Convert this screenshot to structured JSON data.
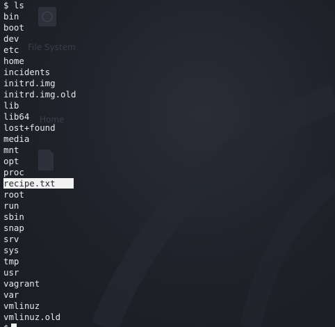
{
  "desktop": {
    "file_system_label": "File System",
    "home_label": "Home"
  },
  "terminal": {
    "command_line": "$ ls",
    "entries": [
      "bin",
      "boot",
      "dev",
      "etc",
      "home",
      "incidents",
      "initrd.img",
      "initrd.img.old",
      "lib",
      "lib64",
      "lost+found",
      "media",
      "mnt",
      "opt",
      "proc",
      "recipe.txt",
      "root",
      "run",
      "sbin",
      "snap",
      "srv",
      "sys",
      "tmp",
      "usr",
      "vagrant",
      "var",
      "vmlinuz",
      "vmlinuz.old"
    ],
    "highlighted_entry": "recipe.txt",
    "prompt": "$",
    "colors": {
      "background": "#1f2129",
      "text": "#e8e8e8",
      "selection": "#f2f2f2"
    }
  }
}
